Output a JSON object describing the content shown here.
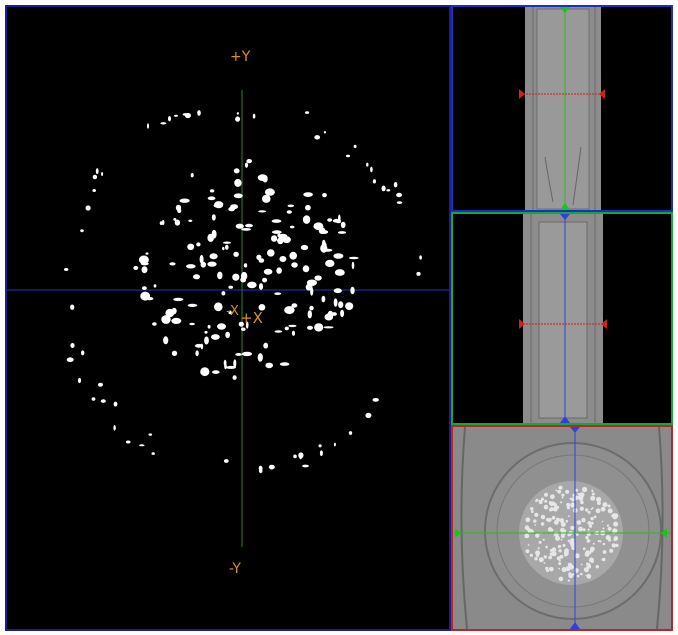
{
  "main_view": {
    "labels": {
      "plus_y": "+Y",
      "minus_y": "-Y",
      "minus_x": "-X",
      "plus_x": "+X"
    },
    "crosshair": {
      "vertical_color": "#1f8a2a",
      "horizontal_color": "#2630c0"
    }
  },
  "side_views": {
    "top": {
      "border_color": "#1b2fc8",
      "h_line_color": "#d02020",
      "v_line_color": "#20c020"
    },
    "middle": {
      "border_color": "#13a83a",
      "h_line_color": "#d02020",
      "v_line_color": "#3040e0"
    },
    "bottom": {
      "border_color": "#b8262a",
      "h_line_color": "#20c020",
      "v_line_color": "#3040e0"
    }
  },
  "colors": {
    "label": "#d8902a",
    "background": "#000000",
    "tissue": "#8a8a8a"
  }
}
